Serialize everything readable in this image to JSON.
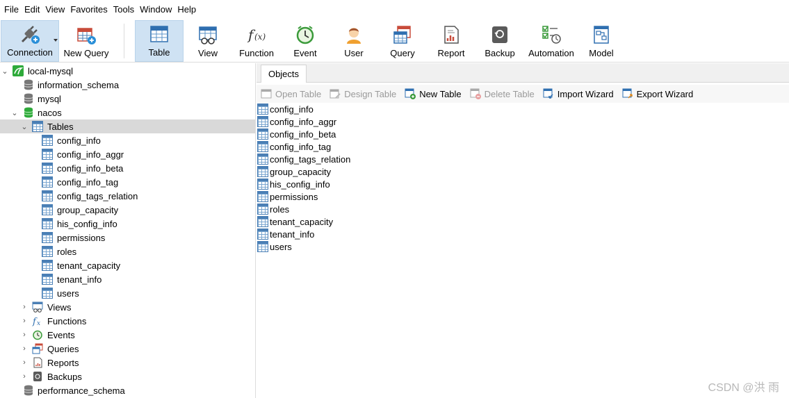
{
  "menu": [
    "File",
    "Edit",
    "View",
    "Favorites",
    "Tools",
    "Window",
    "Help"
  ],
  "toolbar": {
    "connection": "Connection",
    "new_query": "New Query",
    "table": "Table",
    "view": "View",
    "function": "Function",
    "event": "Event",
    "user": "User",
    "query": "Query",
    "report": "Report",
    "backup": "Backup",
    "automation": "Automation",
    "model": "Model"
  },
  "tree": {
    "connection": "local-mysql",
    "databases": {
      "information_schema": "information_schema",
      "mysql": "mysql",
      "nacos": "nacos",
      "performance_schema": "performance_schema"
    },
    "tables_label": "Tables",
    "tables": [
      "config_info",
      "config_info_aggr",
      "config_info_beta",
      "config_info_tag",
      "config_tags_relation",
      "group_capacity",
      "his_config_info",
      "permissions",
      "roles",
      "tenant_capacity",
      "tenant_info",
      "users"
    ],
    "groups": {
      "views": "Views",
      "functions": "Functions",
      "events": "Events",
      "queries": "Queries",
      "reports": "Reports",
      "backups": "Backups"
    }
  },
  "objects_tab": "Objects",
  "object_toolbar": {
    "open_table": "Open Table",
    "design_table": "Design Table",
    "new_table": "New Table",
    "delete_table": "Delete Table",
    "import_wizard": "Import Wizard",
    "export_wizard": "Export Wizard"
  },
  "object_list": [
    "config_info",
    "config_info_aggr",
    "config_info_beta",
    "config_info_tag",
    "config_tags_relation",
    "group_capacity",
    "his_config_info",
    "permissions",
    "roles",
    "tenant_capacity",
    "tenant_info",
    "users"
  ],
  "watermark": "CSDN @洪 雨",
  "colors": {
    "active_tool_bg": "#cfe2f3",
    "selected_row_bg": "#d9d9d9",
    "nacos_green": "#2eaa3a",
    "table_blue": "#4a7fb5"
  }
}
